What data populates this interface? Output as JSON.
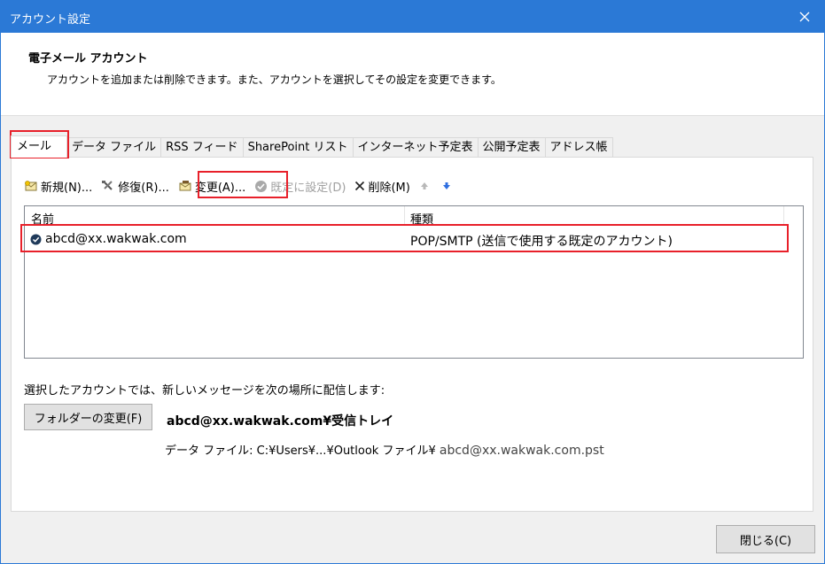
{
  "window": {
    "title": "アカウント設定",
    "close_icon": "close-icon"
  },
  "header": {
    "title": "電子メール アカウント",
    "description": "アカウントを追加または削除できます。また、アカウントを選択してその設定を変更できます。"
  },
  "tabs": [
    {
      "label": "メール",
      "active": true
    },
    {
      "label": "データ ファイル"
    },
    {
      "label": "RSS フィード"
    },
    {
      "label": "SharePoint リスト"
    },
    {
      "label": "インターネット予定表"
    },
    {
      "label": "公開予定表"
    },
    {
      "label": "アドレス帳"
    }
  ],
  "toolbar": {
    "new_label": "新規(N)...",
    "repair_label": "修復(R)...",
    "change_label": "変更(A)...",
    "set_default_label": "既定に設定(D)",
    "delete_label": "削除(M)"
  },
  "list": {
    "col_name": "名前",
    "col_type": "種類",
    "rows": [
      {
        "name": "abcd@xx.wakwak.com",
        "type": "POP/SMTP (送信で使用する既定のアカウント)"
      }
    ]
  },
  "delivery": {
    "label": "選択したアカウントでは、新しいメッセージを次の場所に配信します:",
    "folder_button": "フォルダーの変更(F)",
    "target": "abcd@xx.wakwak.com¥受信トレイ",
    "datafile_prefix": "データ ファイル: C:¥Users¥...¥Outlook ファイル¥",
    "datafile_name": "abcd@xx.wakwak.com.pst"
  },
  "footer": {
    "close_button": "閉じる(C)"
  },
  "colors": {
    "titlebar": "#2b79d6",
    "highlight": "#e8202a"
  }
}
